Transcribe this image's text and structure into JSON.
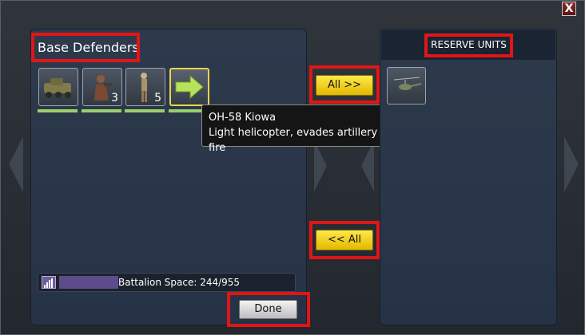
{
  "close_label": "X",
  "left_panel": {
    "title": "Base Defenders"
  },
  "right_panel": {
    "title": "RESERVE UNITS"
  },
  "units": [
    {
      "name": "armored-vehicle-icon",
      "count": ""
    },
    {
      "name": "infantry-squad-icon",
      "count": "3"
    },
    {
      "name": "soldier-icon",
      "count": "5"
    },
    {
      "name": "arrow-right-icon",
      "count": ""
    }
  ],
  "reserve_units": [
    {
      "name": "helicopter-icon"
    }
  ],
  "tooltip": {
    "title": "OH-58 Kiowa",
    "description": "Light helicopter, evades artillery fire"
  },
  "buttons": {
    "all_right": "All >>",
    "all_left": "<< All",
    "done": "Done"
  },
  "battalion": {
    "label": "Battalion Space: 244/955",
    "used": 244,
    "total": 955
  },
  "colors": {
    "accent_yellow": "#f6cf12",
    "highlight_red": "#e01616",
    "panel": "#2a3648",
    "bar_green": "#9ccf6b"
  }
}
